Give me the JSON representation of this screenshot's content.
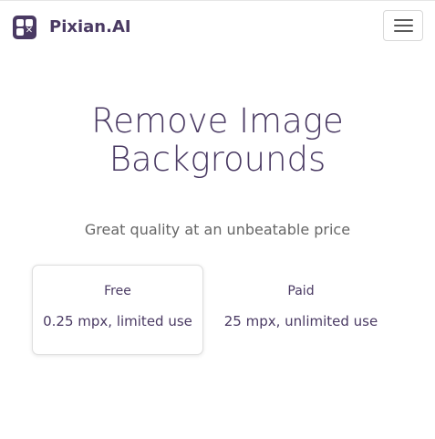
{
  "header": {
    "brand_name": "Pixian.AI",
    "logo_icon": "pixian-logo-icon",
    "menu_icon": "hamburger-menu-icon"
  },
  "hero": {
    "title_line1": "Remove Image",
    "title_line2": "Backgrounds",
    "subtitle": "Great quality at an unbeatable price"
  },
  "plans": [
    {
      "name": "Free",
      "description": "0.25 mpx, limited use",
      "selected": true
    },
    {
      "name": "Paid",
      "description": "25 mpx, unlimited use",
      "selected": false
    }
  ],
  "colors": {
    "brand": "#4a3a63",
    "subtitle": "#666666",
    "card_border": "#dedede"
  }
}
